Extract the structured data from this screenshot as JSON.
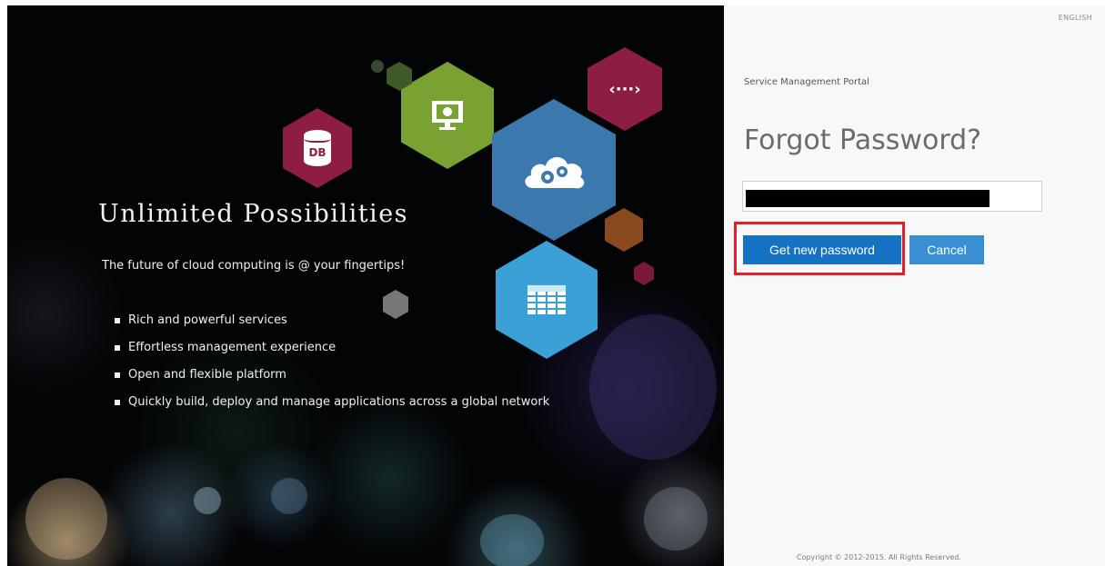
{
  "hero": {
    "title": "Unlimited Possibilities",
    "subtitle": "The future of cloud computing is @ your fingertips!",
    "features": [
      "Rich and powerful services",
      "Effortless management experience",
      "Open and flexible platform",
      "Quickly build, deploy and manage applications across a global network"
    ],
    "icons": {
      "database_label": "DB",
      "api_label": "‹···›"
    },
    "colors": {
      "maroon": "#8e1d43",
      "green": "#79a232",
      "steel_blue": "#3b78ad",
      "light_blue": "#3aa0d6",
      "orange_brown": "#8a4a1e",
      "gray": "#777777"
    }
  },
  "panel": {
    "language": "ENGLISH",
    "portal_name": "Service Management Portal",
    "form_title": "Forgot Password?",
    "email_value": "",
    "primary_button": "Get new password",
    "cancel_button": "Cancel",
    "copyright": "Copyright © 2012-2015. All Rights Reserved.",
    "colors": {
      "primary": "#1672c3",
      "secondary": "#3a8fd2",
      "highlight": "#e0202c"
    }
  }
}
